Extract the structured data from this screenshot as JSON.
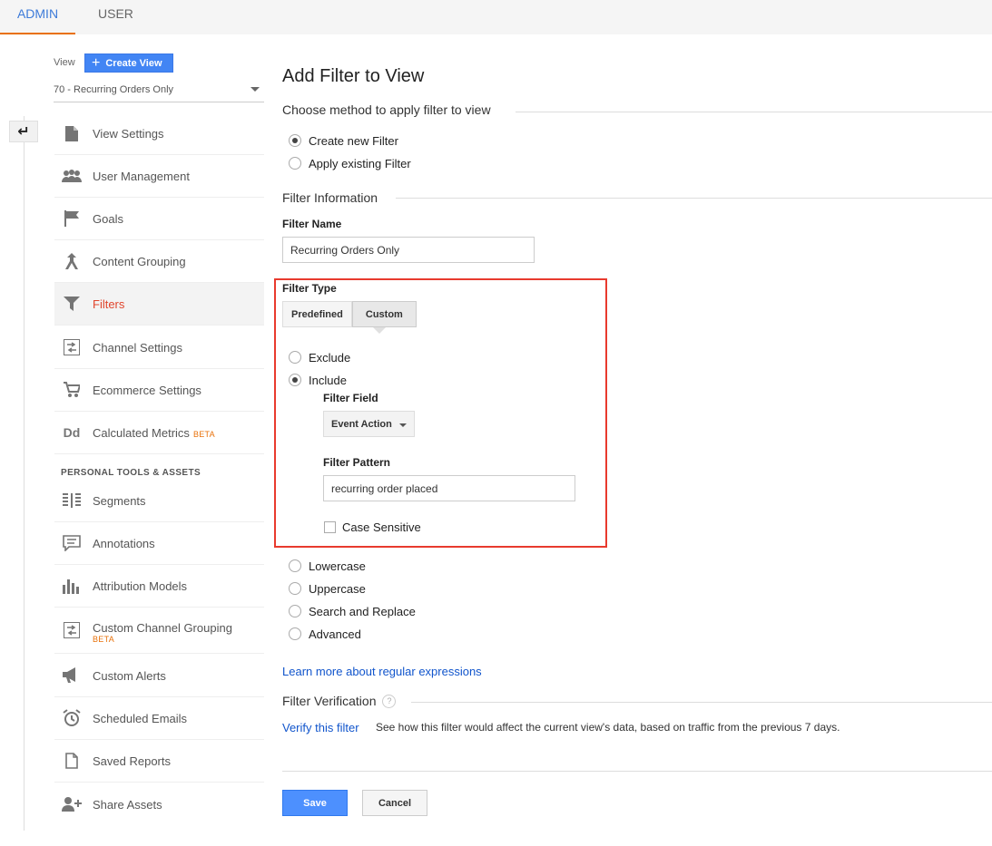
{
  "tabs": {
    "admin": "ADMIN",
    "user": "USER"
  },
  "view": {
    "label": "View",
    "create_button": "Create View",
    "selected": "70 - Recurring Orders Only"
  },
  "nav": {
    "items": [
      {
        "label": "View Settings",
        "icon": "page-icon"
      },
      {
        "label": "User Management",
        "icon": "people-icon"
      },
      {
        "label": "Goals",
        "icon": "flag-icon"
      },
      {
        "label": "Content Grouping",
        "icon": "grouping-icon"
      },
      {
        "label": "Filters",
        "icon": "funnel-icon",
        "active": true
      },
      {
        "label": "Channel Settings",
        "icon": "channel-icon"
      },
      {
        "label": "Ecommerce Settings",
        "icon": "cart-icon"
      },
      {
        "label": "Calculated Metrics",
        "icon": "dd-icon",
        "badge": "BETA"
      }
    ],
    "section_heading": "PERSONAL TOOLS & ASSETS",
    "personal_items": [
      {
        "label": "Segments",
        "icon": "segments-icon"
      },
      {
        "label": "Annotations",
        "icon": "comment-icon"
      },
      {
        "label": "Attribution Models",
        "icon": "bar-chart-icon"
      },
      {
        "label": "Custom Channel Grouping",
        "icon": "channel-icon",
        "badge": "BETA"
      },
      {
        "label": "Custom Alerts",
        "icon": "megaphone-icon"
      },
      {
        "label": "Scheduled Emails",
        "icon": "clock-icon"
      },
      {
        "label": "Saved Reports",
        "icon": "document-icon"
      },
      {
        "label": "Share Assets",
        "icon": "add-person-icon"
      }
    ]
  },
  "main": {
    "title": "Add Filter to View",
    "method_heading": "Choose method to apply filter to view",
    "method_options": [
      "Create new Filter",
      "Apply existing Filter"
    ],
    "method_selected": "Create new Filter",
    "info_heading": "Filter Information",
    "filter_name_label": "Filter Name",
    "filter_name_value": "Recurring Orders Only",
    "filter_type_label": "Filter Type",
    "filter_type_tabs": [
      "Predefined",
      "Custom"
    ],
    "filter_type_selected": "Custom",
    "type_options": [
      "Exclude",
      "Include"
    ],
    "type_selected": "Include",
    "filter_field_label": "Filter Field",
    "filter_field_value": "Event Action",
    "filter_pattern_label": "Filter Pattern",
    "filter_pattern_value": "recurring order placed",
    "case_sensitive_label": "Case Sensitive",
    "case_sensitive_checked": false,
    "other_options": [
      "Lowercase",
      "Uppercase",
      "Search and Replace",
      "Advanced"
    ],
    "regex_link": "Learn more about regular expressions",
    "verification_heading": "Filter Verification",
    "help_glyph": "?",
    "verify_link": "Verify this filter",
    "verify_description": "See how this filter would affect the current view's data, based on traffic from the previous 7 days.",
    "save_label": "Save",
    "cancel_label": "Cancel"
  },
  "colors": {
    "accent_blue": "#4285f4",
    "active_red": "#e0442c",
    "highlight_border": "#e83a2e",
    "tab_underline": "#e8710a"
  }
}
